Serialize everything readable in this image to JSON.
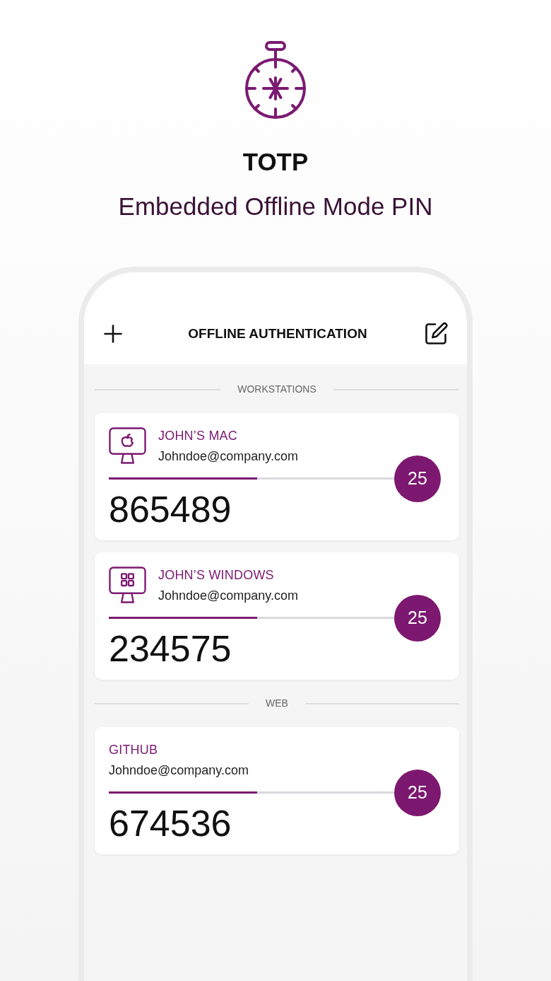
{
  "hero": {
    "title": "TOTP",
    "subtitle": "Embedded Offline Mode PIN"
  },
  "app": {
    "header": {
      "title": "OFFLINE AUTHENTICATION"
    },
    "sections": [
      {
        "label": "WORKSTATIONS",
        "accounts": [
          {
            "kind": "mac",
            "name": "JOHN’S MAC",
            "email": "Johndoe@company.com",
            "level": 0.52,
            "countdown": "25",
            "code": "865489"
          },
          {
            "kind": "windows",
            "name": "JOHN’S WINDOWS",
            "email": "Johndoe@company.com",
            "level": 0.52,
            "countdown": "25",
            "code": "234575"
          }
        ]
      },
      {
        "label": "WEB",
        "accounts": [
          {
            "kind": "web",
            "name": "GITHUB",
            "email": "Johndoe@company.com",
            "level": 0.52,
            "countdown": "25",
            "code": "674536"
          }
        ]
      }
    ]
  }
}
